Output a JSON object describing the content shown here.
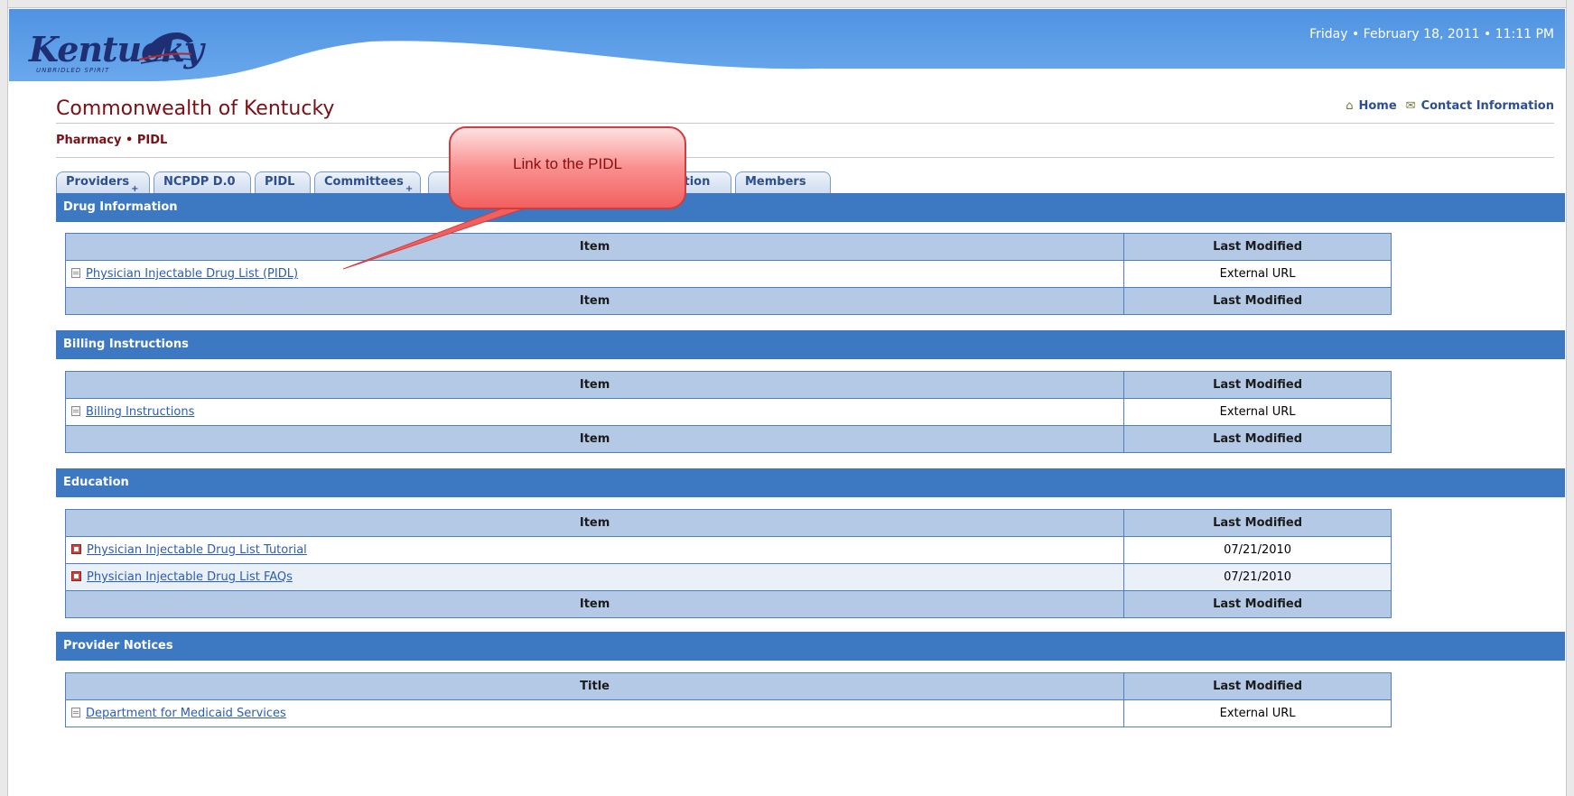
{
  "header": {
    "logo_text": "Kentucky",
    "logo_tagline": "UNBRIDLED SPIRIT",
    "datetime": "Friday • February 18, 2011 • 11:11 PM"
  },
  "site": {
    "title": "Commonwealth of Kentucky",
    "breadcrumb": "Pharmacy • PIDL",
    "links": [
      {
        "label": "Home",
        "icon": "home-icon"
      },
      {
        "label": "Contact Information",
        "icon": "contact-icon"
      }
    ]
  },
  "tabs": [
    {
      "label": "Providers",
      "plus": "+"
    },
    {
      "label": "NCPDP D.0",
      "plus": ""
    },
    {
      "label": "PIDL",
      "plus": ""
    },
    {
      "label": "Committees",
      "plus": "+"
    },
    {
      "label": "sation",
      "plus": ""
    },
    {
      "label": "Members",
      "plus": ""
    }
  ],
  "callout": {
    "text": "Link to the PIDL"
  },
  "sections": [
    {
      "title": "Drug Information",
      "col_item": "Item",
      "col_modified": "Last Modified",
      "rows": [
        {
          "label": "Physician Injectable Drug List (PIDL)",
          "modified": "External URL",
          "icon": "document-icon"
        }
      ]
    },
    {
      "title": "Billing Instructions",
      "col_item": "Item",
      "col_modified": "Last Modified",
      "rows": [
        {
          "label": "Billing Instructions",
          "modified": "External URL",
          "icon": "document-icon"
        }
      ]
    },
    {
      "title": "Education",
      "col_item": "Item",
      "col_modified": "Last Modified",
      "rows": [
        {
          "label": "Physician Injectable Drug List Tutorial",
          "modified": "07/21/2010",
          "icon": "pdf-icon"
        },
        {
          "label": "Physician Injectable Drug List FAQs",
          "modified": "07/21/2010",
          "icon": "pdf-icon"
        }
      ]
    },
    {
      "title": "Provider Notices",
      "col_item": "Title",
      "col_modified": "Last Modified",
      "rows": [
        {
          "label": "Department for Medicaid Services",
          "modified": "External URL",
          "icon": "document-icon"
        }
      ]
    }
  ],
  "colors": {
    "header_blue": "#5b9be0",
    "section_bar": "#3d78c2",
    "table_header": "#b4c9e6",
    "title_maroon": "#7a1016",
    "link_blue": "#2b5db3",
    "callout_red": "#f25f5f"
  }
}
